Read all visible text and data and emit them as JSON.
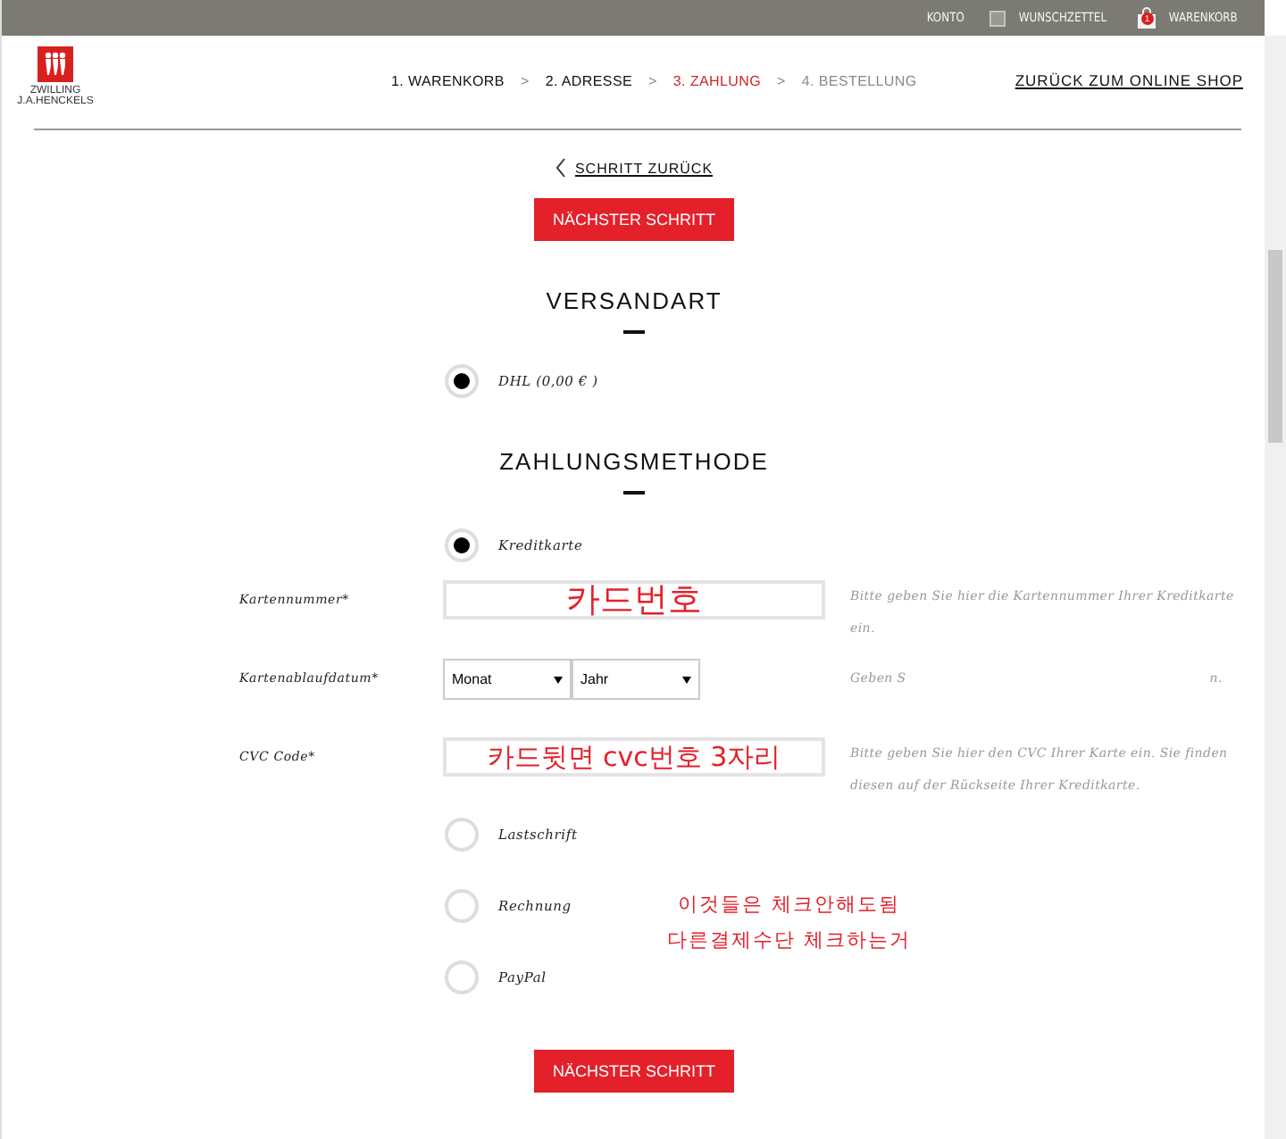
{
  "top_bar": {
    "links": [
      {
        "kind": "text",
        "label": "KONTO"
      },
      {
        "kind": "wishlist",
        "label": "WUNSCHZETTEL"
      },
      {
        "kind": "cart",
        "label": "WARENKORB",
        "badge": "1"
      }
    ]
  },
  "header": {
    "logo_lines": [
      "ZWILLING",
      "J.A.HENCKELS"
    ],
    "steps": [
      {
        "label": "1. WARENKORB",
        "kind": "done"
      },
      {
        "label": "2. ADRESSE",
        "kind": "done"
      },
      {
        "label": "3. ZAHLUNG",
        "kind": "current"
      },
      {
        "label": "4. BESTELLUNG",
        "kind": "todo"
      }
    ],
    "separator": ">",
    "back_to_shop": "ZURÜCK ZUM ONLINE SHOP"
  },
  "back_link": "SCHRITT ZURÜCK",
  "next_button": "NÄCHSTER SCHRITT",
  "shipping": {
    "title": "VERSANDART",
    "options": [
      {
        "label": "DHL (0,00 € )",
        "selected": true
      }
    ]
  },
  "payment": {
    "title": "ZAHLUNGSMETHODE",
    "options": [
      {
        "label": "Kreditkarte",
        "selected": true
      }
    ],
    "card_fields": [
      {
        "kind": "text",
        "label": "Kartennummer*",
        "annotation": "카드번호",
        "hint": "Bitte geben Sie hier die Kartennummer Ihrer Kreditkarte ein."
      },
      {
        "kind": "date",
        "label": "Kartenablaufdatum*",
        "selects": [
          "Monat",
          "Jahr"
        ],
        "hint_parts": [
          "Geben S",
          "n."
        ]
      },
      {
        "kind": "text",
        "label": "CVC Code*",
        "annotation": "카드뒷면 cvc번호 3자리",
        "hint": "Bitte geben Sie hier den CVC Ihrer Karte ein. Sie finden diesen auf der Rückseite Ihrer Kreditkarte."
      }
    ],
    "other_options": [
      {
        "label": "Lastschrift",
        "selected": false
      },
      {
        "label": "Rechnung",
        "selected": false
      },
      {
        "label": "PayPal",
        "selected": false
      }
    ],
    "note": [
      "이것들은 체크안해도됨",
      "다른결제수단 체크하는거"
    ]
  },
  "bottom_button": "NÄCHSTER SCHRITT"
}
